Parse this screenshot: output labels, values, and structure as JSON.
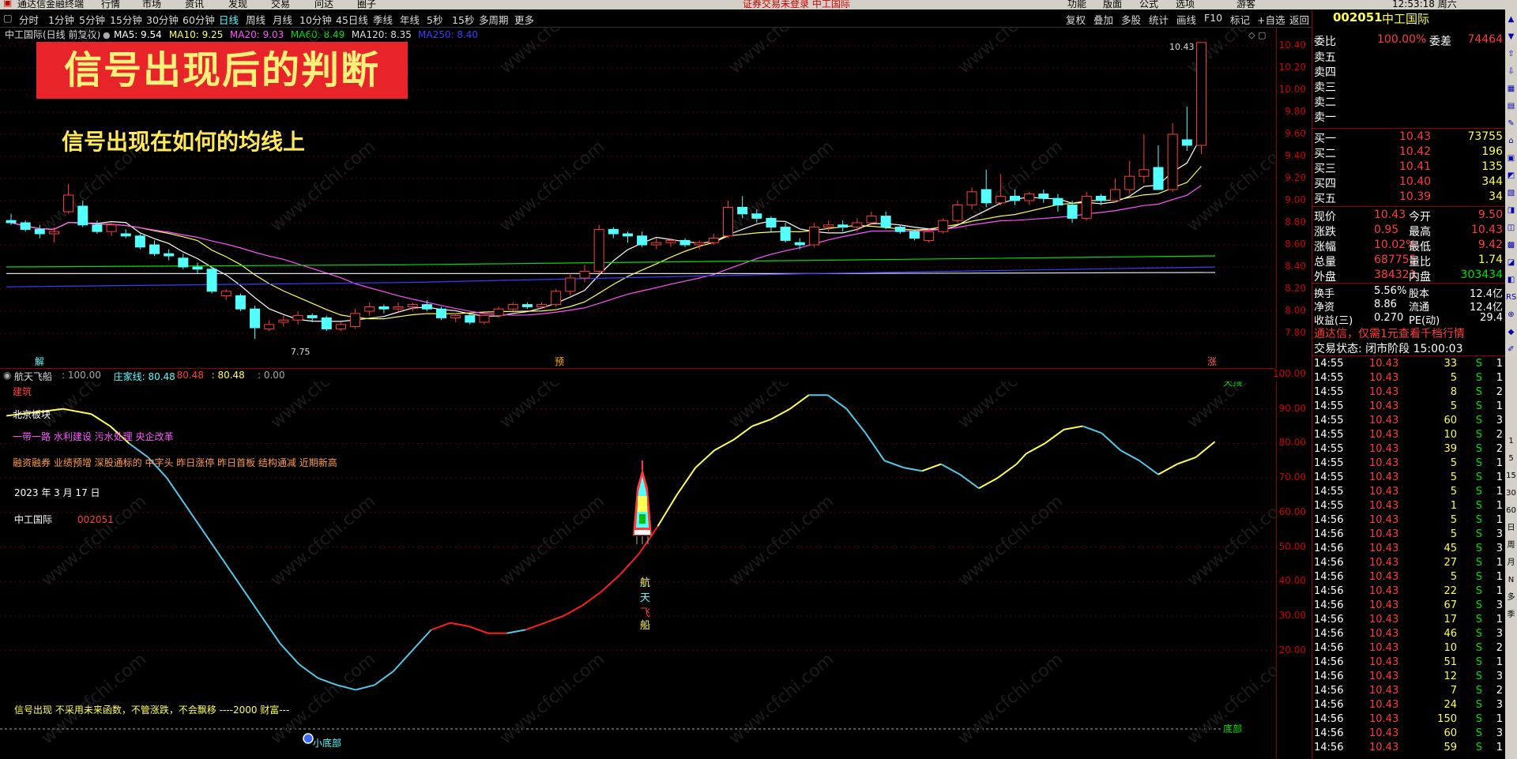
{
  "menubar": {
    "app_title": "通达信金融终端",
    "menus": [
      "行情",
      "市场",
      "资讯",
      "发现",
      "交易",
      "问达",
      "圈子"
    ],
    "center_notice": "证券交易未登录  中工国际",
    "right_menus": [
      "功能",
      "版面",
      "公式",
      "选项"
    ],
    "time": "12:53:18 周六",
    "extra": "游客"
  },
  "periodbar": {
    "periods": [
      "分时",
      "1分钟",
      "5分钟",
      "15分钟",
      "30分钟",
      "60分钟",
      "日线",
      "周线",
      "月线",
      "10分钟",
      "45日线",
      "季线",
      "年线",
      "5秒",
      "15秒",
      "多周期",
      "更多"
    ],
    "active": "日线",
    "tools": [
      "复权",
      "叠加",
      "多股",
      "统计",
      "画线",
      "F10",
      "标记",
      "+自选",
      "返回"
    ]
  },
  "mainchart": {
    "header_name": "中工国际(日线 前复权)",
    "ma": [
      {
        "label": "MA5: 9.54",
        "color": "#ffffff"
      },
      {
        "label": "MA10: 9.25",
        "color": "#ffff54"
      },
      {
        "label": "MA20: 9.03",
        "color": "#ff54ff"
      },
      {
        "label": "MA60: 8.49",
        "color": "#00e000"
      },
      {
        "label": "MA120: 8.35",
        "color": "#dddddd"
      },
      {
        "label": "MA250: 8.40",
        "color": "#3c3cff"
      }
    ],
    "banner": "信号出现后的判断",
    "subtitle": "信号出现在如何的均线上",
    "high_label": "10.43",
    "low_label": "7.75",
    "markers": [
      "解",
      "预",
      "涨"
    ],
    "yaxis": [
      "10.40",
      "10.20",
      "10.00",
      "9.80",
      "9.60",
      "9.40",
      "9.20",
      "9.00",
      "8.80",
      "8.60",
      "8.40",
      "8.20",
      "8.00",
      "7.80"
    ],
    "watermark": "www.cfchi.com"
  },
  "subchart": {
    "header": "航天飞船",
    "header_vals": [
      {
        "label": ": 100.00",
        "color": "#aaaaaa"
      },
      {
        "label": "庄家线: 80.48",
        "color": "#54ffff"
      },
      {
        "label": "80.48",
        "color": "#ff3c3c"
      },
      {
        "label": ": 80.48",
        "color": "#ffff54"
      },
      {
        "label": ": 0.00",
        "color": "#aaaaaa"
      }
    ],
    "notes": {
      "sector": "建筑",
      "block": "北京板块",
      "concepts": "一带一路 水利建设 污水处理 央企改革",
      "tags": "融资融券 业绩预增 深股通标的 中字头 昨日涨停 昨日首板 结构通减 近期新高",
      "date": "2023 年 3 月 17 日",
      "stock_name": "中工国际",
      "stock_code": "002051",
      "disclaimer": "信号出现  不采用未来函数，不管涨跌，不会飘移 ----2000 财富---"
    },
    "labels": {
      "top_tag": "天顶",
      "bottom_tag": "底部",
      "small_bottom": "小底部",
      "rocket_chars": [
        "航",
        "天",
        "飞",
        "船"
      ]
    },
    "yaxis": [
      "100.00",
      "90.00",
      "80.00",
      "70.00",
      "60.00",
      "50.00",
      "40.00",
      "30.00",
      "20.00"
    ]
  },
  "rightpanel": {
    "code": "002051",
    "name": "中工国际",
    "weibi_label": "委比",
    "weibi": "100.00%",
    "weicha_label": "委差",
    "weicha": "74464",
    "sells": [
      "卖五",
      "卖四",
      "卖三",
      "卖二",
      "卖一"
    ],
    "buys": [
      {
        "label": "买一",
        "price": "10.43",
        "vol": "73755"
      },
      {
        "label": "买二",
        "price": "10.42",
        "vol": "196"
      },
      {
        "label": "买三",
        "price": "10.41",
        "vol": "135"
      },
      {
        "label": "买四",
        "price": "10.40",
        "vol": "344"
      },
      {
        "label": "买五",
        "price": "10.39",
        "vol": "34"
      }
    ],
    "stats": [
      {
        "l1": "现价",
        "v1": "10.43",
        "l2": "今开",
        "v2": "9.50"
      },
      {
        "l1": "涨跌",
        "v1": "0.95",
        "l2": "最高",
        "v2": "10.43"
      },
      {
        "l1": "涨幅",
        "v1": "10.02%",
        "l2": "最低",
        "v2": "9.42"
      },
      {
        "l1": "总量",
        "v1": "687755",
        "l2": "量比",
        "v2": "1.74"
      },
      {
        "l1": "外盘",
        "v1": "384321",
        "l2": "内盘",
        "v2": "303434"
      }
    ],
    "stats2": [
      {
        "l1": "换手",
        "v1": "5.56%",
        "l2": "股本",
        "v2": "12.4亿"
      },
      {
        "l1": "净资",
        "v1": "8.86",
        "l2": "流通",
        "v2": "12.4亿"
      },
      {
        "l1": "收益(三)",
        "v1": "0.270",
        "l2": "PE(动)",
        "v2": "29.4"
      }
    ],
    "promo": "通达信，仅需1元查看千档行情",
    "status": "交易状态: 闭市阶段 15:00:03",
    "ticks": [
      [
        "14:55",
        "10.43",
        "33",
        "S"
      ],
      [
        "14:55",
        "10.43",
        "5",
        "S"
      ],
      [
        "14:55",
        "10.43",
        "8",
        "S"
      ],
      [
        "14:55",
        "10.43",
        "5",
        "S"
      ],
      [
        "14:55",
        "10.43",
        "60",
        "S"
      ],
      [
        "14:55",
        "10.43",
        "10",
        "S"
      ],
      [
        "14:55",
        "10.43",
        "39",
        "S"
      ],
      [
        "14:55",
        "10.43",
        "5",
        "S"
      ],
      [
        "14:55",
        "10.43",
        "5",
        "S"
      ],
      [
        "14:55",
        "10.43",
        "5",
        "S"
      ],
      [
        "14:55",
        "10.43",
        "1",
        "S"
      ],
      [
        "14:56",
        "10.43",
        "5",
        "S"
      ],
      [
        "14:56",
        "10.43",
        "5",
        "S"
      ],
      [
        "14:56",
        "10.43",
        "45",
        "S"
      ],
      [
        "14:56",
        "10.43",
        "27",
        "S"
      ],
      [
        "14:56",
        "10.43",
        "5",
        "S"
      ],
      [
        "14:56",
        "10.43",
        "22",
        "S"
      ],
      [
        "14:56",
        "10.43",
        "67",
        "S"
      ],
      [
        "14:56",
        "10.43",
        "17",
        "S"
      ],
      [
        "14:56",
        "10.43",
        "46",
        "S"
      ],
      [
        "14:56",
        "10.43",
        "10",
        "S"
      ],
      [
        "14:56",
        "10.43",
        "51",
        "S"
      ],
      [
        "14:56",
        "10.43",
        "12",
        "S"
      ],
      [
        "14:56",
        "10.43",
        "7",
        "S"
      ],
      [
        "14:56",
        "10.43",
        "24",
        "S"
      ],
      [
        "14:56",
        "10.43",
        "150",
        "S"
      ],
      [
        "14:56",
        "10.43",
        "60",
        "S"
      ],
      [
        "14:56",
        "10.43",
        "59",
        "S"
      ]
    ],
    "tick_counts": [
      "1",
      "1",
      "2",
      "1",
      "3",
      "2",
      "2",
      "1",
      "1",
      "1",
      "1",
      "1",
      "3",
      "3",
      "1",
      "1",
      "1",
      "3",
      "1",
      "3",
      "2",
      "1",
      "3",
      "2",
      "3",
      "1",
      "3",
      "1"
    ]
  },
  "iconcol": {
    "items": [
      "日",
      "周",
      "月",
      "N",
      "多",
      "季"
    ],
    "pcts": [
      "1",
      "5",
      "15",
      "30",
      "60"
    ]
  },
  "candles": [
    [
      8.82,
      8.88,
      8.78,
      8.8
    ],
    [
      8.8,
      8.82,
      8.72,
      8.74
    ],
    [
      8.74,
      8.78,
      8.66,
      8.7
    ],
    [
      8.7,
      8.76,
      8.62,
      8.72
    ],
    [
      8.9,
      9.15,
      8.88,
      9.05
    ],
    [
      8.95,
      9.0,
      8.76,
      8.78
    ],
    [
      8.78,
      8.82,
      8.7,
      8.72
    ],
    [
      8.72,
      8.8,
      8.68,
      8.78
    ],
    [
      8.7,
      8.74,
      8.66,
      8.68
    ],
    [
      8.68,
      8.7,
      8.56,
      8.58
    ],
    [
      8.6,
      8.64,
      8.5,
      8.52
    ],
    [
      8.52,
      8.56,
      8.46,
      8.5
    ],
    [
      8.48,
      8.52,
      8.38,
      8.4
    ],
    [
      8.4,
      8.44,
      8.34,
      8.38
    ],
    [
      8.38,
      8.4,
      8.16,
      8.18
    ],
    [
      8.14,
      8.2,
      8.1,
      8.18
    ],
    [
      8.14,
      8.16,
      8.0,
      8.02
    ],
    [
      8.02,
      8.05,
      7.75,
      7.85
    ],
    [
      7.84,
      7.92,
      7.82,
      7.88
    ],
    [
      7.9,
      7.96,
      7.86,
      7.92
    ],
    [
      7.92,
      8.0,
      7.88,
      7.96
    ],
    [
      7.96,
      7.98,
      7.9,
      7.94
    ],
    [
      7.94,
      7.96,
      7.82,
      7.84
    ],
    [
      7.84,
      7.9,
      7.82,
      7.88
    ],
    [
      7.86,
      8.02,
      7.84,
      7.98
    ],
    [
      8.0,
      8.08,
      7.96,
      8.04
    ],
    [
      8.04,
      8.06,
      7.98,
      8.02
    ],
    [
      8.02,
      8.08,
      7.98,
      8.04
    ],
    [
      8.04,
      8.08,
      8.0,
      8.06
    ],
    [
      8.06,
      8.1,
      8.0,
      8.02
    ],
    [
      8.02,
      8.04,
      7.92,
      7.94
    ],
    [
      7.94,
      7.98,
      7.9,
      7.96
    ],
    [
      7.96,
      7.98,
      7.88,
      7.9
    ],
    [
      7.9,
      7.98,
      7.88,
      7.96
    ],
    [
      7.96,
      8.04,
      7.94,
      8.02
    ],
    [
      8.02,
      8.08,
      8.0,
      8.06
    ],
    [
      8.06,
      8.08,
      8.02,
      8.04
    ],
    [
      8.04,
      8.08,
      8.02,
      8.06
    ],
    [
      8.06,
      8.2,
      8.04,
      8.18
    ],
    [
      8.18,
      8.34,
      8.14,
      8.3
    ],
    [
      8.3,
      8.42,
      8.26,
      8.36
    ],
    [
      8.36,
      8.78,
      8.34,
      8.74
    ],
    [
      8.74,
      8.76,
      8.66,
      8.7
    ],
    [
      8.7,
      8.72,
      8.62,
      8.68
    ],
    [
      8.68,
      8.72,
      8.58,
      8.6
    ],
    [
      8.6,
      8.66,
      8.56,
      8.62
    ],
    [
      8.62,
      8.66,
      8.58,
      8.64
    ],
    [
      8.64,
      8.66,
      8.58,
      8.6
    ],
    [
      8.6,
      8.64,
      8.56,
      8.62
    ],
    [
      8.62,
      8.7,
      8.6,
      8.66
    ],
    [
      8.68,
      9.0,
      8.66,
      8.94
    ],
    [
      8.94,
      9.04,
      8.84,
      8.88
    ],
    [
      8.88,
      8.92,
      8.8,
      8.84
    ],
    [
      8.84,
      8.86,
      8.72,
      8.76
    ],
    [
      8.76,
      8.8,
      8.62,
      8.64
    ],
    [
      8.62,
      8.66,
      8.56,
      8.6
    ],
    [
      8.6,
      8.8,
      8.58,
      8.76
    ],
    [
      8.76,
      8.82,
      8.72,
      8.78
    ],
    [
      8.78,
      8.82,
      8.72,
      8.76
    ],
    [
      8.76,
      8.84,
      8.72,
      8.8
    ],
    [
      8.8,
      8.9,
      8.78,
      8.86
    ],
    [
      8.86,
      8.9,
      8.74,
      8.76
    ],
    [
      8.76,
      8.78,
      8.7,
      8.72
    ],
    [
      8.72,
      8.74,
      8.64,
      8.66
    ],
    [
      8.64,
      8.74,
      8.62,
      8.72
    ],
    [
      8.72,
      8.84,
      8.7,
      8.82
    ],
    [
      8.82,
      9.0,
      8.8,
      8.96
    ],
    [
      8.96,
      9.12,
      8.92,
      9.08
    ],
    [
      9.1,
      9.28,
      8.94,
      8.98
    ],
    [
      8.98,
      9.24,
      8.96,
      9.04
    ],
    [
      9.04,
      9.1,
      8.96,
      9.0
    ],
    [
      9.0,
      9.08,
      8.96,
      9.06
    ],
    [
      9.06,
      9.1,
      8.98,
      9.02
    ],
    [
      9.02,
      9.06,
      8.9,
      8.96
    ],
    [
      8.96,
      9.0,
      8.8,
      8.84
    ],
    [
      8.84,
      9.08,
      8.82,
      9.04
    ],
    [
      9.04,
      9.06,
      8.96,
      9.0
    ],
    [
      9.0,
      9.2,
      8.98,
      9.1
    ],
    [
      9.1,
      9.36,
      9.06,
      9.22
    ],
    [
      9.22,
      9.6,
      9.16,
      9.28
    ],
    [
      9.3,
      9.5,
      9.1,
      9.1
    ],
    [
      9.1,
      9.7,
      9.08,
      9.6
    ],
    [
      9.55,
      9.85,
      9.45,
      9.5
    ],
    [
      9.5,
      10.43,
      9.42,
      10.43
    ]
  ],
  "oscillator": [
    [
      0,
      88
    ],
    [
      3,
      89
    ],
    [
      6,
      90
    ],
    [
      9,
      88.5
    ],
    [
      11,
      85
    ],
    [
      13,
      80
    ],
    [
      15,
      76
    ],
    [
      17,
      70
    ],
    [
      19,
      62
    ],
    [
      21,
      54
    ],
    [
      23,
      46
    ],
    [
      25,
      38
    ],
    [
      27,
      30
    ],
    [
      29,
      22
    ],
    [
      31,
      16
    ],
    [
      33,
      12
    ],
    [
      35,
      10
    ],
    [
      37,
      8.6
    ],
    [
      39,
      10
    ],
    [
      41,
      14
    ],
    [
      43,
      20
    ],
    [
      45,
      26
    ],
    [
      47,
      28
    ],
    [
      49,
      27
    ],
    [
      51,
      25
    ],
    [
      53,
      25
    ],
    [
      55,
      26
    ],
    [
      57,
      28
    ],
    [
      59,
      30
    ],
    [
      61,
      33
    ],
    [
      63,
      37
    ],
    [
      65,
      42
    ],
    [
      67,
      48
    ],
    [
      69,
      56
    ],
    [
      71,
      65
    ],
    [
      73,
      73
    ],
    [
      75,
      78
    ],
    [
      77,
      81
    ],
    [
      79,
      85
    ],
    [
      81,
      87
    ],
    [
      83,
      90
    ],
    [
      85,
      94
    ],
    [
      87,
      94
    ],
    [
      89,
      90
    ],
    [
      91,
      83
    ],
    [
      93,
      75
    ],
    [
      95,
      73
    ],
    [
      97,
      72
    ],
    [
      99,
      74
    ],
    [
      101,
      71
    ],
    [
      103,
      67
    ],
    [
      105,
      70
    ],
    [
      107,
      74
    ],
    [
      108,
      77
    ],
    [
      110,
      80
    ],
    [
      112,
      84
    ],
    [
      114,
      85
    ],
    [
      116,
      83
    ],
    [
      118,
      78
    ],
    [
      120,
      75
    ],
    [
      122,
      71
    ],
    [
      124,
      74
    ],
    [
      126,
      76
    ],
    [
      128,
      80.5
    ]
  ]
}
